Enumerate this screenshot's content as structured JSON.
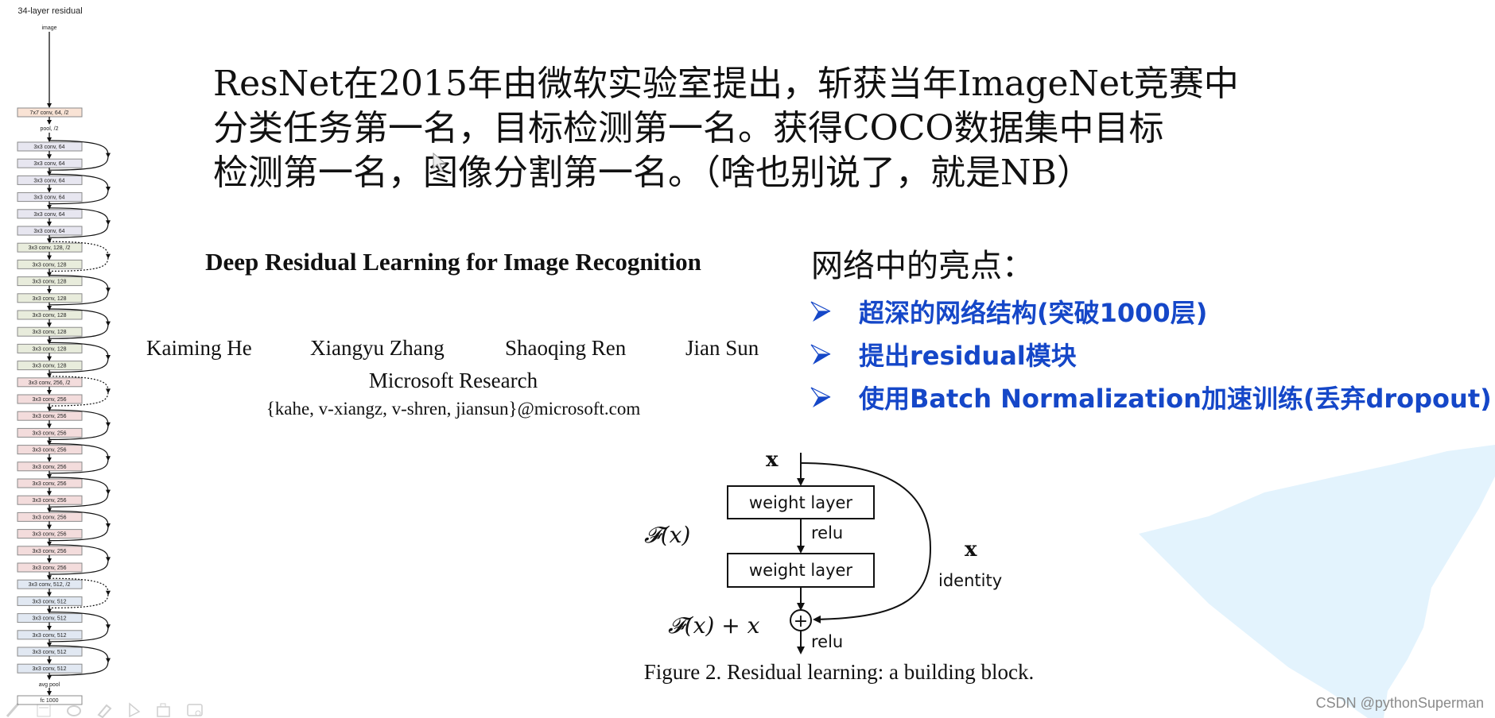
{
  "colors": {
    "highlight_blue": "#1547c8",
    "splash_blue": "#e3f3fd",
    "box_stage1": "#f9e3d5",
    "box_stage64": "#e7e6f0",
    "box_stage128": "#e8ecdc",
    "box_stage256": "#f3dcdc",
    "box_stage512": "#e1e8f2"
  },
  "network": {
    "title": "34-layer residual",
    "input_label": "image",
    "stem_conv": "7x7 conv, 64, /2",
    "pool_label": "pool, /2",
    "stages": [
      {
        "stage": "64",
        "blocks": [
          "3x3 conv, 64",
          "3x3 conv, 64",
          "3x3 conv, 64",
          "3x3 conv, 64",
          "3x3 conv, 64",
          "3x3 conv, 64"
        ]
      },
      {
        "stage": "128",
        "blocks": [
          "3x3 conv, 128, /2",
          "3x3 conv, 128",
          "3x3 conv, 128",
          "3x3 conv, 128",
          "3x3 conv, 128",
          "3x3 conv, 128",
          "3x3 conv, 128",
          "3x3 conv, 128"
        ]
      },
      {
        "stage": "256",
        "blocks": [
          "3x3 conv, 256, /2",
          "3x3 conv, 256",
          "3x3 conv, 256",
          "3x3 conv, 256",
          "3x3 conv, 256",
          "3x3 conv, 256",
          "3x3 conv, 256",
          "3x3 conv, 256",
          "3x3 conv, 256",
          "3x3 conv, 256",
          "3x3 conv, 256",
          "3x3 conv, 256"
        ]
      },
      {
        "stage": "512",
        "blocks": [
          "3x3 conv, 512, /2",
          "3x3 conv, 512",
          "3x3 conv, 512",
          "3x3 conv, 512",
          "3x3 conv, 512",
          "3x3 conv, 512"
        ]
      }
    ],
    "avgpool_label": "avg pool",
    "fc_label": "fc 1000"
  },
  "heading": {
    "lines": [
      "ResNet在2015年由微软实验室提出，斩获当年ImageNet竞赛中",
      "分类任务第一名，目标检测第一名。获得COCO数据集中目标",
      "检测第一名，图像分割第一名。（啥也别说了，就是NB）"
    ]
  },
  "paper": {
    "title": "Deep Residual Learning for Image Recognition",
    "authors": [
      "Kaiming He",
      "Xiangyu Zhang",
      "Shaoqing Ren",
      "Jian Sun"
    ],
    "affiliation": "Microsoft Research",
    "email": "{kahe, v-xiangz, v-shren, jiansun}@microsoft.com"
  },
  "highlights": {
    "title": "网络中的亮点：",
    "items": [
      "超深的网络结构(突破1000层)",
      "提出residual模块",
      "使用Batch Normalization加速训练(丢弃dropout)"
    ]
  },
  "figure": {
    "input_label": "x",
    "layer1_label": "weight layer",
    "relu1_label": "relu",
    "layer2_label": "weight layer",
    "fx_label": "𝓕(x)",
    "sum_label": "𝓕(x) + x",
    "identity_x_label": "x",
    "identity_label": "identity",
    "plus_symbol": "+",
    "relu2_label": "relu",
    "caption": "Figure 2. Residual learning: a building block."
  },
  "toolbar": {
    "icons": [
      "pen-icon",
      "slide-icon",
      "link-icon",
      "eraser-icon",
      "pointer-icon",
      "camera-icon",
      "screen-record-icon"
    ]
  },
  "watermark": "CSDN @pythonSuperman"
}
